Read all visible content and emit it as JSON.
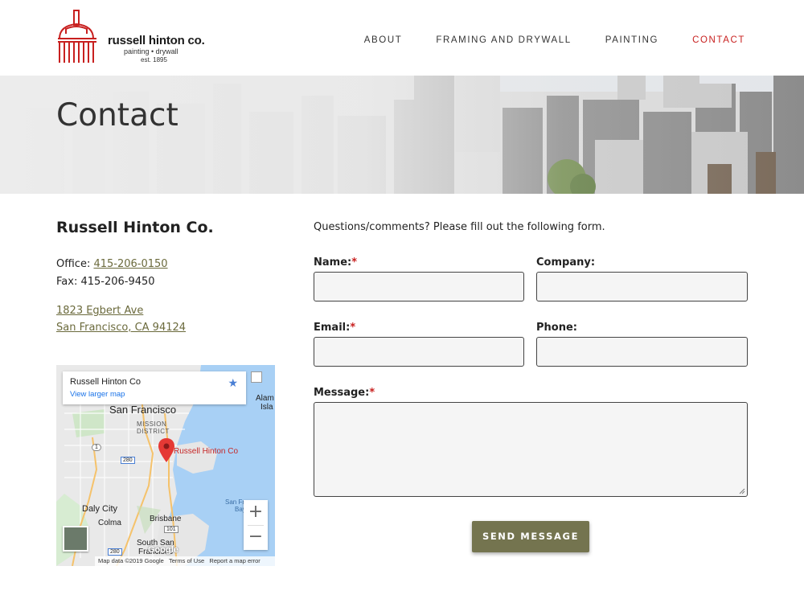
{
  "brand": {
    "name": "russell hinton co.",
    "tagline": "painting • drywall",
    "est": "est. 1895",
    "color": "#c8201f"
  },
  "nav": {
    "items": [
      {
        "label": "ABOUT",
        "active": false
      },
      {
        "label": "FRAMING AND DRYWALL",
        "active": false
      },
      {
        "label": "PAINTING",
        "active": false
      },
      {
        "label": "CONTACT",
        "active": true
      }
    ]
  },
  "hero": {
    "title": "Contact"
  },
  "contact": {
    "company": "Russell Hinton Co.",
    "office_label": "Office: ",
    "office_phone": "415-206-0150",
    "fax": "Fax: 415-206-9450",
    "address_line1": "1823 Egbert Ave",
    "address_line2": "San Francisco, CA 94124",
    "link_color": "#6b6a3c"
  },
  "map": {
    "place_name": "Russell Hinton Co",
    "view_larger": "View larger map",
    "marker_label": "Russell Hinton Co",
    "labels": {
      "san_francisco": "San Francisco",
      "mission": "MISSION",
      "district": "DISTRICT",
      "daly_city": "Daly City",
      "colma": "Colma",
      "brisbane": "Brisbane",
      "south_san": "South San",
      "francisco": "Francisco",
      "alam": "Alam",
      "isla": "Isla",
      "san_fr_bay": "San Fr",
      "bay": "Bay",
      "route_1": "1",
      "route_280": "280",
      "route_101": "101",
      "route_280b": "280"
    },
    "zoom_in": "+",
    "zoom_out": "−",
    "google": "Google",
    "footer_data": "Map data ©2019 Google",
    "footer_terms": "Terms of Use",
    "footer_report": "Report a map error"
  },
  "form": {
    "intro": "Questions/comments? Please fill out the following form.",
    "name_label": "Name:",
    "company_label": "Company:",
    "email_label": "Email:",
    "phone_label": "Phone:",
    "message_label": "Message:",
    "required_mark": "*",
    "name_value": "",
    "company_value": "",
    "email_value": "",
    "phone_value": "",
    "message_value": "",
    "submit": "SEND MESSAGE",
    "submit_color": "#74744f"
  }
}
